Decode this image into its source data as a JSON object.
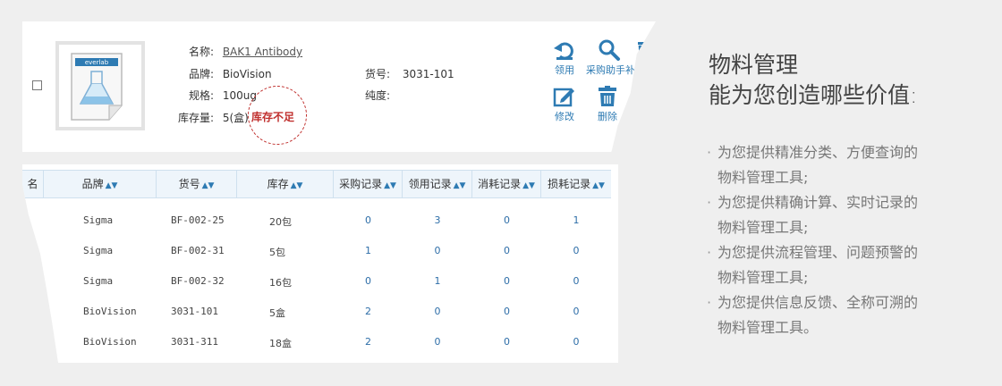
{
  "product": {
    "name_label": "名称:",
    "name_value": "BAK1 Antibody",
    "brand_label": "品牌:",
    "brand_value": "BioVision",
    "spec_label": "规格:",
    "spec_value": "100ug",
    "stock_label": "库存量:",
    "stock_value": "5(盒)",
    "sku_label": "货号:",
    "sku_value": "3031-101",
    "purity_label": "纯度:",
    "purity_value": "",
    "stamp": "库存不足",
    "logo_text": "everlab"
  },
  "actions": {
    "use": "领用",
    "assistant": "采购助手补充",
    "edit": "修改",
    "delete": "删除"
  },
  "table": {
    "headers": [
      "品牌",
      "货号",
      "库存",
      "采购记录",
      "领用记录",
      "消耗记录",
      "损耗记录"
    ],
    "rows": [
      [
        "Sigma",
        "BF-002-25",
        "20包",
        "0",
        "3",
        "0",
        "1"
      ],
      [
        "Sigma",
        "BF-002-31",
        "5包",
        "1",
        "0",
        "0",
        "0"
      ],
      [
        "Sigma",
        "BF-002-32",
        "16包",
        "0",
        "1",
        "0",
        "0"
      ],
      [
        "BioVision",
        "3031-101",
        "5盒",
        "2",
        "0",
        "0",
        "0"
      ],
      [
        "BioVision",
        "3031-311",
        "18盒",
        "2",
        "0",
        "0",
        "0"
      ]
    ]
  },
  "promo": {
    "title1": "物料管理",
    "title2": "能为您创造哪些价值:",
    "bullets": [
      {
        "line1": "为您提供精准分类、方便查询的",
        "line2": "物料管理工具;"
      },
      {
        "line1": "为您提供精确计算、实时记录的",
        "line2": "物料管理工具;"
      },
      {
        "line1": "为您提供流程管理、问题预警的",
        "line2": "物料管理工具;"
      },
      {
        "line1": "为您提供信息反馈、全称可溯的",
        "line2": "物料管理工具。"
      }
    ]
  },
  "colors": {
    "accent": "#2e7bb3",
    "warning": "#c0302e"
  }
}
